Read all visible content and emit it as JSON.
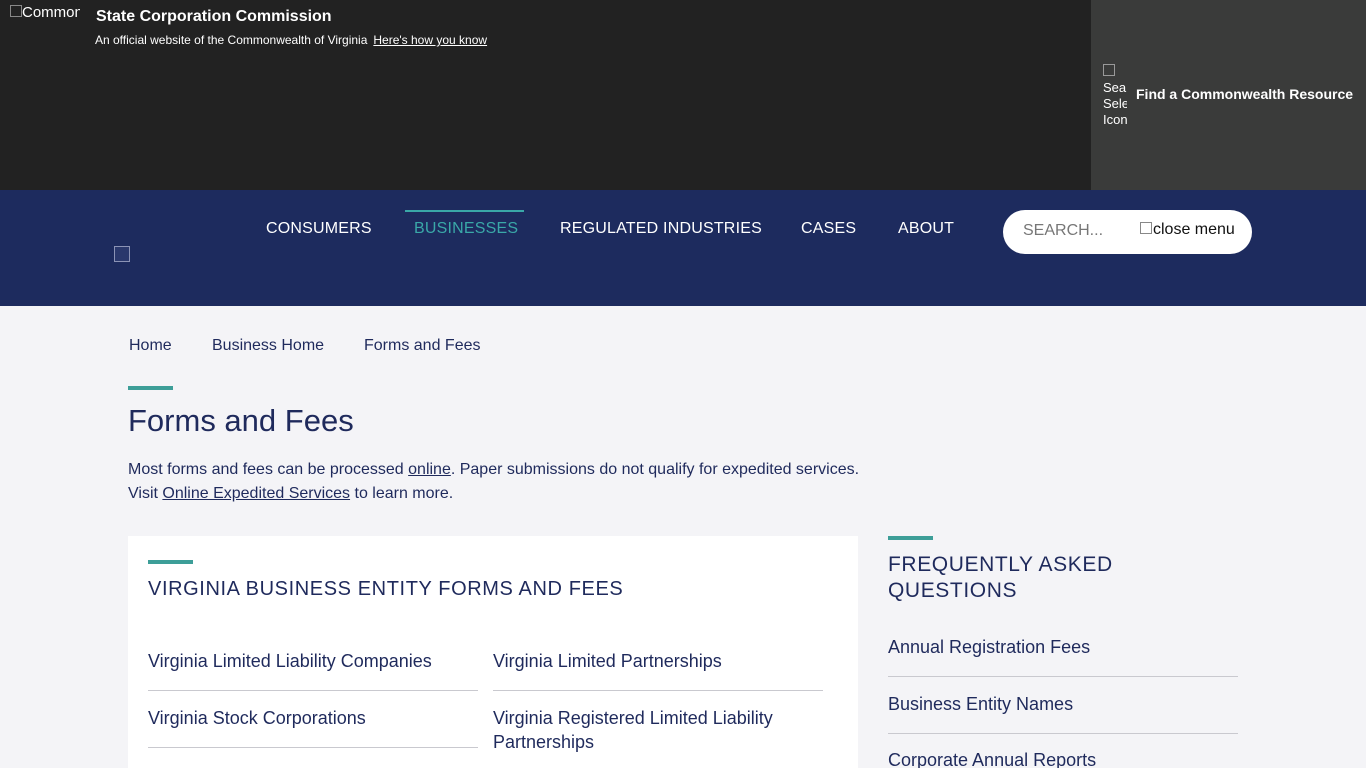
{
  "banner": {
    "logo_alt": "Commonwealth",
    "title": "State Corporation Commission",
    "subtitle": "An official website of the Commonwealth of Virginia",
    "how_link": "Here's how you know",
    "resource_icon_alt": "Search Select Icon",
    "resource_label": "Find a Commonwealth Resource"
  },
  "nav": {
    "items": [
      {
        "label": "CONSUMERS"
      },
      {
        "label": "BUSINESSES"
      },
      {
        "label": "REGULATED INDUSTRIES"
      },
      {
        "label": "CASES"
      },
      {
        "label": "ABOUT"
      }
    ],
    "active": "BUSINESSES",
    "search_placeholder": "SEARCH...",
    "close_alt": "close menu"
  },
  "breadcrumb": [
    "Home",
    "Business Home",
    "Forms and Fees"
  ],
  "page": {
    "title": "Forms and Fees",
    "intro_1a": "Most forms and fees can be processed ",
    "intro_link1": "online",
    "intro_1b": ".  Paper submissions do not qualify for expedited services.",
    "intro_2a": "Visit ",
    "intro_link2": "Online Expedited Services",
    "intro_2b": " to learn more."
  },
  "card": {
    "heading": "VIRGINIA BUSINESS ENTITY FORMS AND FEES",
    "links": [
      "Virginia Limited Liability Companies",
      "Virginia Limited Partnerships",
      "Virginia Stock Corporations",
      "Virginia Registered Limited Liability Partnerships"
    ]
  },
  "faq": {
    "heading": "FREQUENTLY ASKED QUESTIONS",
    "links": [
      "Annual Registration Fees",
      "Business Entity Names",
      "Corporate Annual Reports"
    ]
  },
  "colors": {
    "banner_bg": "#222222",
    "resource_bg": "#3a3b3a",
    "nav_bg": "#1d2b5e",
    "accent": "#3d9e98",
    "active_nav": "#3aa8a8",
    "text": "#1f2a5c",
    "page_bg": "#f4f4f7"
  }
}
